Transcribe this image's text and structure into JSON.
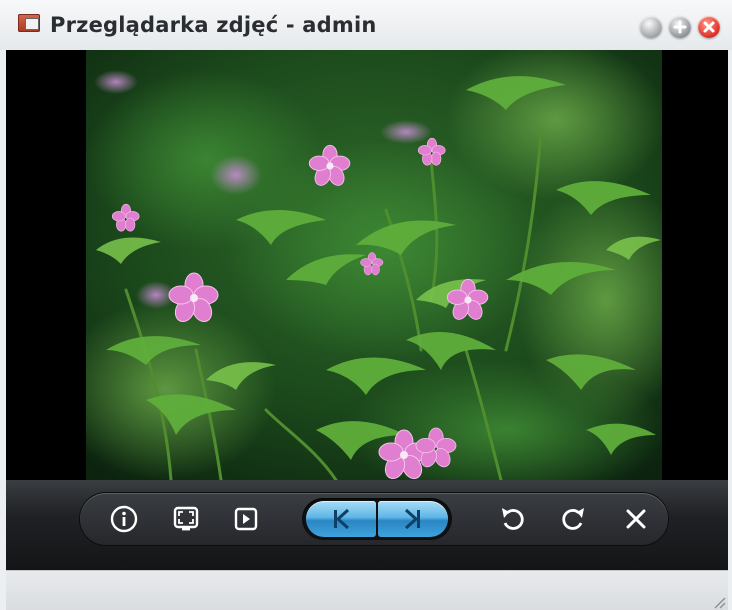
{
  "window": {
    "title": "Przeglądarka zdjęć - admin",
    "app_icon": "photo-viewer-icon"
  },
  "title_buttons": [
    {
      "name": "minimize-icon"
    },
    {
      "name": "maximize-icon"
    },
    {
      "name": "close-icon"
    }
  ],
  "viewer": {
    "image_subject": "pink wildflowers among green ferns"
  },
  "toolbar": {
    "buttons": [
      {
        "name": "info-icon"
      },
      {
        "name": "fullscreen-icon"
      },
      {
        "name": "slideshow-icon"
      },
      {
        "name": "previous-icon"
      },
      {
        "name": "next-icon"
      },
      {
        "name": "rotate-left-icon"
      },
      {
        "name": "rotate-right-icon"
      },
      {
        "name": "close-icon"
      }
    ],
    "accent_color": "#3ea3dd"
  }
}
